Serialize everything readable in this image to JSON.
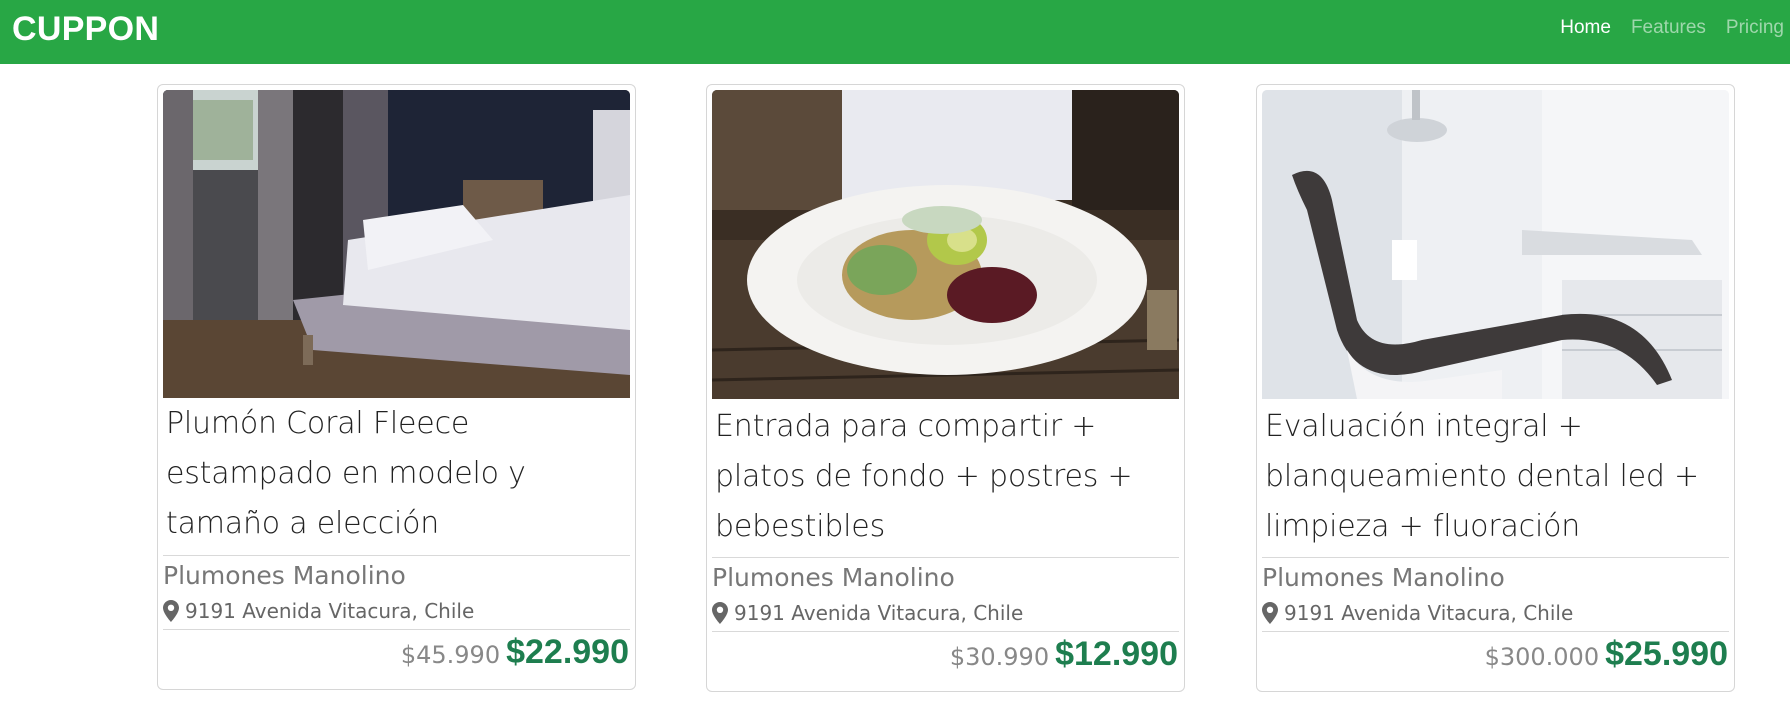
{
  "navbar": {
    "brand": "CUPPON",
    "links": [
      {
        "label": "Home",
        "active": true
      },
      {
        "label": "Features",
        "active": false
      },
      {
        "label": "Pricing",
        "active": false
      }
    ],
    "color": "#28a745"
  },
  "cards": [
    {
      "image": "bedroom-bed-photo",
      "title": "Plumón Coral Fleece estampado en modelo y tamaño a elección",
      "merchant": "Plumones Manolino",
      "address": "9191 Avenida Vitacura, Chile",
      "old_price": "$45.990",
      "new_price": "$22.990"
    },
    {
      "image": "salad-plate-photo",
      "title": "Entrada para compartir + platos de fondo + postres + bebestibles",
      "merchant": "Plumones Manolino",
      "address": "9191 Avenida Vitacura, Chile",
      "old_price": "$30.990",
      "new_price": "$12.990"
    },
    {
      "image": "dental-chair-photo",
      "title": "Evaluación integral + blanqueamiento dental led + limpieza + fluoración",
      "merchant": "Plumones Manolino",
      "address": "9191 Avenida Vitacura, Chile",
      "old_price": "$300.000",
      "new_price": "$25.990"
    }
  ],
  "icons": {
    "address": "map-marker-icon"
  },
  "colors": {
    "price_accent": "#1e7e4f",
    "muted_text": "#777777"
  }
}
